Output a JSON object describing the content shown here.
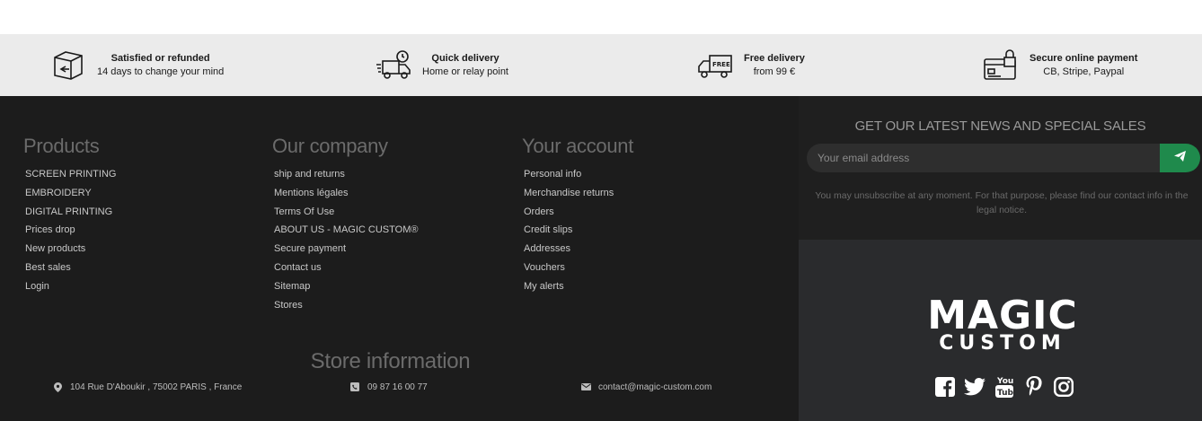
{
  "reassurance": [
    {
      "icon": "box-return-icon",
      "title": "Satisfied or refunded",
      "sub": "14 days to change your mind"
    },
    {
      "icon": "delivery-truck-clock-icon",
      "title": "Quick delivery",
      "sub": "Home or relay point"
    },
    {
      "icon": "free-truck-icon",
      "title": "Free delivery",
      "sub": "from 99 €"
    },
    {
      "icon": "credit-card-lock-icon",
      "title": "Secure online payment",
      "sub": "CB, Stripe, Paypal"
    }
  ],
  "products": {
    "title": "Products",
    "items": [
      "SCREEN PRINTING",
      "EMBROIDERY",
      "DIGITAL PRINTING",
      "Prices drop",
      "New products",
      "Best sales",
      "Login"
    ]
  },
  "company": {
    "title": "Our company",
    "items": [
      "ship and returns",
      "Mentions légales",
      "Terms Of Use",
      "ABOUT US - MAGIC CUSTOM®",
      "Secure payment",
      "Contact us",
      "Sitemap",
      "Stores"
    ]
  },
  "account": {
    "title": "Your account",
    "items": [
      "Personal info",
      "Merchandise returns",
      "Orders",
      "Credit slips",
      "Addresses",
      "Vouchers",
      "My alerts"
    ]
  },
  "store": {
    "title": "Store information",
    "address": "104 Rue D'Aboukir , 75002 PARIS , France",
    "phone": "09 87 16 00 77",
    "email": "contact@magic-custom.com"
  },
  "newsletter": {
    "title": "GET OUR LATEST NEWS AND SPECIAL SALES",
    "placeholder": "Your email address",
    "note": "You may unsubscribe at any moment. For that purpose, please find our contact info in the legal notice."
  },
  "logo": {
    "line1": "MAGIC",
    "line2": "CUSTOM"
  },
  "social": [
    "facebook-icon",
    "twitter-icon",
    "youtube-icon",
    "pinterest-icon",
    "instagram-icon"
  ],
  "colors": {
    "accent": "#1f8a4c",
    "footer_bg": "#1c1c1c",
    "band_bg": "#ebebeb"
  }
}
